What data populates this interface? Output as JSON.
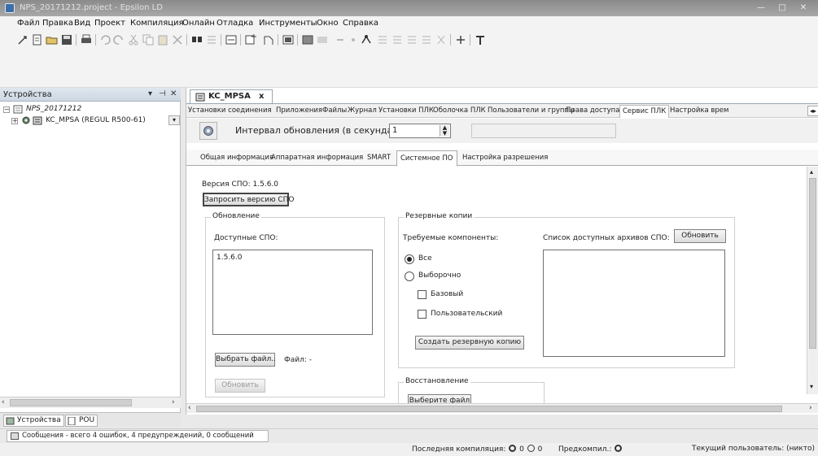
{
  "window": {
    "title": "NPS_20171212.project - Epsilon LD",
    "buttons": {
      "minimize": "—",
      "maximize": "□",
      "close": "✕"
    }
  },
  "menu": [
    "Файл",
    "Правка",
    "Вид",
    "Проект",
    "Компиляция",
    "Онлайн",
    "Отладка",
    "Инструменты",
    "Окно",
    "Справка"
  ],
  "devices_panel": {
    "title": "Устройства",
    "pin_icon": "pin-icon",
    "tree": {
      "project": "NPS_20171212",
      "device": "KC_MPSA (REGUL R500-61)"
    },
    "bottom_tabs": [
      "Устройства",
      "POU"
    ]
  },
  "editor": {
    "doc_tab": {
      "label": "KC_MPSA",
      "close": "x"
    },
    "page_tabs": [
      "Установки соединения",
      "Приложения",
      "Файлы",
      "Журнал",
      "Установки ПЛК",
      "Оболочка ПЛК",
      "Пользователи и группы",
      "Права доступа",
      "Сервис ПЛК",
      "Настройка врем"
    ],
    "active_page_tab": "Сервис ПЛК",
    "refresh_interval": {
      "label": "Интервал обновления (в секундах):",
      "value": "1"
    },
    "sub_tabs": [
      "Общая информация",
      "Аппаратная информация",
      "SMART",
      "Системное ПО",
      "Настройка разрешения"
    ],
    "active_sub_tab": "Системное ПО",
    "version": {
      "label": "Версия СПО:",
      "value": "1.5.6.0"
    },
    "request_button": "Запросить версию СПО",
    "update": {
      "title": "Обновление",
      "available_label": "Доступные СПО:",
      "items": [
        "1.5.6.0"
      ],
      "choose_file": "Выбрать файл..",
      "file_label": "Файл:",
      "file_value": "-",
      "update_button": "Обновить"
    },
    "backup": {
      "title": "Резервные копии",
      "components_label": "Требуемые компоненты:",
      "archives_label": "Список доступных архивов СПО:",
      "refresh_button": "Обновить",
      "options": [
        "Все",
        "Выборочно"
      ],
      "selected_option": "Все",
      "checks": [
        "Базовый",
        "Пользовательский"
      ],
      "create_button": "Создать резервную копию"
    },
    "restore": {
      "title": "Восстановление",
      "choose_file": "Выберите файл"
    }
  },
  "messages": {
    "summary": "Сообщения - всего 4 ошибок, 4 предупреждений, 0 сообщений"
  },
  "status": {
    "last_compile_label": "Последняя компиляция:",
    "counts": [
      "0",
      "0"
    ],
    "precompile_label": "Предкомпил.:",
    "user_label": "Текущий пользователь: (никто)"
  }
}
